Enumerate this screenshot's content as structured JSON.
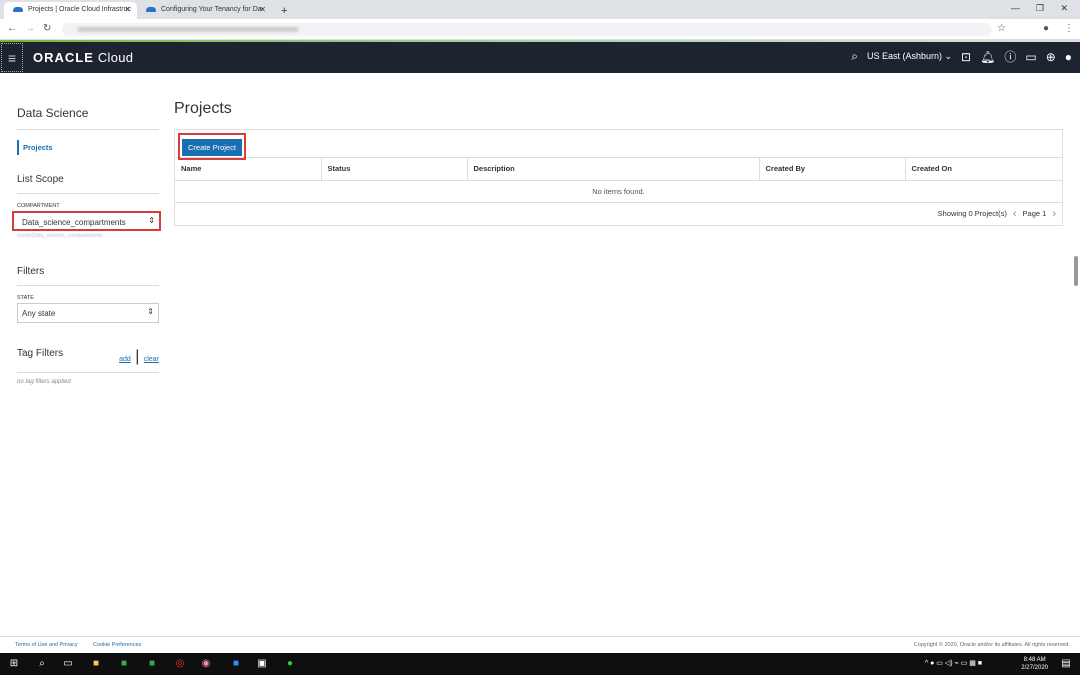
{
  "browser": {
    "tabs": [
      {
        "title": "Projects | Oracle Cloud Infrastruc",
        "active": true
      },
      {
        "title": "Configuring Your Tenancy for Da",
        "active": false
      }
    ]
  },
  "header": {
    "logo_bold": "ORACLE",
    "logo_light": "Cloud",
    "region": "US East (Ashburn)"
  },
  "sidebar": {
    "title": "Data Science",
    "nav": [
      {
        "label": "Projects"
      }
    ],
    "list_scope": "List Scope",
    "compartment_label": "COMPARTMENT",
    "compartment_value": "Data_science_compartments",
    "compartment_path": "(root)/Data_science_compartments",
    "filters": "Filters",
    "state_label": "STATE",
    "state_value": "Any state",
    "tag_filters": "Tag Filters",
    "add": "add",
    "clear": "clear",
    "no_tags": "no tag filters applied"
  },
  "main": {
    "title": "Projects",
    "create_button": "Create Project",
    "columns": [
      "Name",
      "Status",
      "Description",
      "Created By",
      "Created On"
    ],
    "empty": "No items found.",
    "showing": "Showing 0 Project(s)",
    "page": "Page 1"
  },
  "footer": {
    "terms": "Terms of Use and Privacy",
    "cookies": "Cookie Preferences",
    "copyright": "Copyright © 2020, Oracle and/or its affiliates. All rights reserved."
  },
  "taskbar": {
    "time": "8:48 AM",
    "date": "2/27/2020"
  }
}
